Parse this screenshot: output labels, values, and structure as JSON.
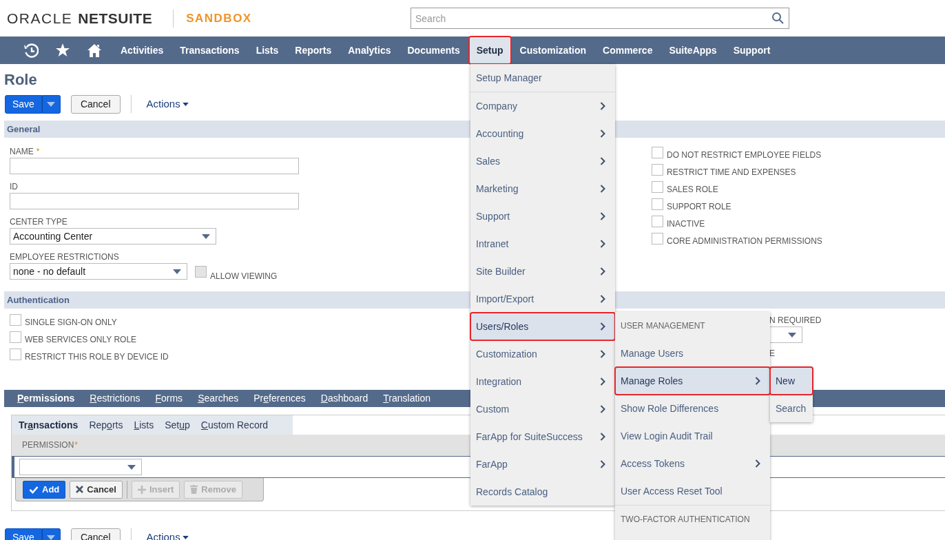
{
  "header": {
    "logo": {
      "brand": "ORACLE",
      "product": "NETSUITE"
    },
    "environment": "SANDBOX",
    "search": {
      "placeholder": "Search"
    }
  },
  "nav": {
    "items": [
      {
        "label": "Activities",
        "selected": false,
        "highlighted": false
      },
      {
        "label": "Transactions",
        "selected": false,
        "highlighted": false
      },
      {
        "label": "Lists",
        "selected": false,
        "highlighted": false
      },
      {
        "label": "Reports",
        "selected": false,
        "highlighted": false
      },
      {
        "label": "Analytics",
        "selected": false,
        "highlighted": false
      },
      {
        "label": "Documents",
        "selected": false,
        "highlighted": false
      },
      {
        "label": "Setup",
        "selected": true,
        "highlighted": true
      },
      {
        "label": "Customization",
        "selected": false,
        "highlighted": false
      },
      {
        "label": "Commerce",
        "selected": false,
        "highlighted": false
      },
      {
        "label": "SuiteApps",
        "selected": false,
        "highlighted": false
      },
      {
        "label": "Support",
        "selected": false,
        "highlighted": false
      }
    ]
  },
  "page_title": "Role",
  "toolbar": {
    "save": "Save",
    "cancel": "Cancel",
    "actions": "Actions"
  },
  "general": {
    "title": "General",
    "fields": [
      {
        "kind": "text",
        "label": "NAME",
        "required_mark": "*"
      },
      {
        "kind": "text",
        "label": "ID"
      },
      {
        "kind": "select",
        "label": "CENTER TYPE",
        "value": "Accounting Center"
      },
      {
        "kind": "select",
        "label": "EMPLOYEE RESTRICTIONS",
        "value": "none - no default",
        "option": {
          "label": "ALLOW VIEWING",
          "checked": false,
          "disabled": true
        }
      }
    ],
    "checkboxes": [
      {
        "label": "DO NOT RESTRICT EMPLOYEE FIELDS",
        "checked": false
      },
      {
        "label": "RESTRICT TIME AND EXPENSES",
        "checked": false
      },
      {
        "label": "SALES ROLE",
        "checked": false
      },
      {
        "label": "SUPPORT ROLE",
        "checked": false
      },
      {
        "label": "INACTIVE",
        "checked": false
      },
      {
        "label": "CORE ADMINISTRATION PERMISSIONS",
        "checked": false
      }
    ]
  },
  "authentication": {
    "title": "Authentication",
    "checkboxes": [
      {
        "label": "SINGLE SIGN-ON ONLY",
        "checked": false
      },
      {
        "label": "WEB SERVICES ONLY ROLE",
        "checked": false
      },
      {
        "label": "RESTRICT THIS ROLE BY DEVICE ID",
        "checked": false
      }
    ],
    "column_2": {
      "label": "N REQUIRED",
      "label_2": "E"
    }
  },
  "subtabs": [
    {
      "key": "P",
      "rest": "ermissions",
      "selected": true
    },
    {
      "key": "R",
      "rest": "estrictions",
      "selected": false
    },
    {
      "key": "F",
      "rest": "orms",
      "selected": false
    },
    {
      "key": "S",
      "rest": "earches",
      "selected": false
    },
    {
      "before": "Pr",
      "key": "e",
      "rest": "ferences",
      "selected": false
    },
    {
      "key": "D",
      "rest": "ashboard",
      "selected": false
    },
    {
      "key": "T",
      "rest": "ranslation",
      "selected": false
    }
  ],
  "permissions": {
    "tabs": [
      {
        "before": "Tr",
        "key": "a",
        "rest": "nsactions",
        "selected": true
      },
      {
        "before": "Rep",
        "key": "o",
        "rest": "rts",
        "selected": false
      },
      {
        "key": "L",
        "rest": "ists",
        "selected": false
      },
      {
        "before": "Set",
        "key": "u",
        "rest": "p",
        "selected": false
      },
      {
        "key": "C",
        "rest": "ustom Record",
        "selected": false
      }
    ],
    "column": "PERMISSION",
    "required_mark": "*",
    "buttons": [
      {
        "kind": "add",
        "label": "Add",
        "disabled": false
      },
      {
        "kind": "cancel",
        "label": "Cancel",
        "disabled": false
      },
      {
        "kind": "insert",
        "label": "Insert",
        "disabled": true
      },
      {
        "kind": "remove",
        "label": "Remove",
        "disabled": true
      }
    ]
  },
  "footer_toolbar": {
    "save": "Save",
    "cancel": "Cancel",
    "actions": "Actions"
  },
  "setup_menu": {
    "items": [
      {
        "kind": "link",
        "label": "Setup Manager",
        "has_submenu": false,
        "selected": false,
        "highlighted": false
      },
      {
        "kind": "divider"
      },
      {
        "kind": "link",
        "label": "Company",
        "has_submenu": true,
        "selected": false,
        "highlighted": false
      },
      {
        "kind": "link",
        "label": "Accounting",
        "has_submenu": true,
        "selected": false,
        "highlighted": false
      },
      {
        "kind": "link",
        "label": "Sales",
        "has_submenu": true,
        "selected": false,
        "highlighted": false
      },
      {
        "kind": "link",
        "label": "Marketing",
        "has_submenu": true,
        "selected": false,
        "highlighted": false
      },
      {
        "kind": "link",
        "label": "Support",
        "has_submenu": true,
        "selected": false,
        "highlighted": false
      },
      {
        "kind": "link",
        "label": "Intranet",
        "has_submenu": true,
        "selected": false,
        "highlighted": false
      },
      {
        "kind": "link",
        "label": "Site Builder",
        "has_submenu": true,
        "selected": false,
        "highlighted": false
      },
      {
        "kind": "link",
        "label": "Import/Export",
        "has_submenu": true,
        "selected": false,
        "highlighted": false
      },
      {
        "kind": "link",
        "label": "Users/Roles",
        "has_submenu": true,
        "selected": true,
        "highlighted": true
      },
      {
        "kind": "link",
        "label": "Customization",
        "has_submenu": true,
        "selected": false,
        "highlighted": false
      },
      {
        "kind": "link",
        "label": "Integration",
        "has_submenu": true,
        "selected": false,
        "highlighted": false
      },
      {
        "kind": "link",
        "label": "Custom",
        "has_submenu": true,
        "selected": false,
        "highlighted": false
      },
      {
        "kind": "link",
        "label": "FarApp for SuiteSuccess",
        "has_submenu": true,
        "selected": false,
        "highlighted": false
      },
      {
        "kind": "link",
        "label": "FarApp",
        "has_submenu": true,
        "selected": false,
        "highlighted": false
      },
      {
        "kind": "link",
        "label": "Records Catalog",
        "has_submenu": false,
        "selected": false,
        "highlighted": false
      }
    ]
  },
  "users_roles_menu": {
    "items": [
      {
        "kind": "header",
        "label": "USER MANAGEMENT"
      },
      {
        "kind": "link",
        "label": "Manage Users",
        "has_submenu": false,
        "selected": false,
        "highlighted": false
      },
      {
        "kind": "link",
        "label": "Manage Roles",
        "has_submenu": true,
        "selected": true,
        "highlighted": true
      },
      {
        "kind": "link",
        "label": "Show Role Differences",
        "has_submenu": false,
        "selected": false,
        "highlighted": false
      },
      {
        "kind": "link",
        "label": "View Login Audit Trail",
        "has_submenu": false,
        "selected": false,
        "highlighted": false
      },
      {
        "kind": "link",
        "label": "Access Tokens",
        "has_submenu": true,
        "selected": false,
        "highlighted": false
      },
      {
        "kind": "link",
        "label": "User Access Reset Tool",
        "has_submenu": false,
        "selected": false,
        "highlighted": false
      },
      {
        "kind": "divider"
      },
      {
        "kind": "header",
        "label": "TWO-FACTOR AUTHENTICATION"
      }
    ]
  },
  "manage_roles_menu": {
    "items": [
      {
        "kind": "link",
        "label": "New",
        "has_submenu": false,
        "selected": true,
        "highlighted": true
      },
      {
        "kind": "link",
        "label": "Search",
        "has_submenu": false,
        "selected": false,
        "highlighted": false
      }
    ]
  }
}
